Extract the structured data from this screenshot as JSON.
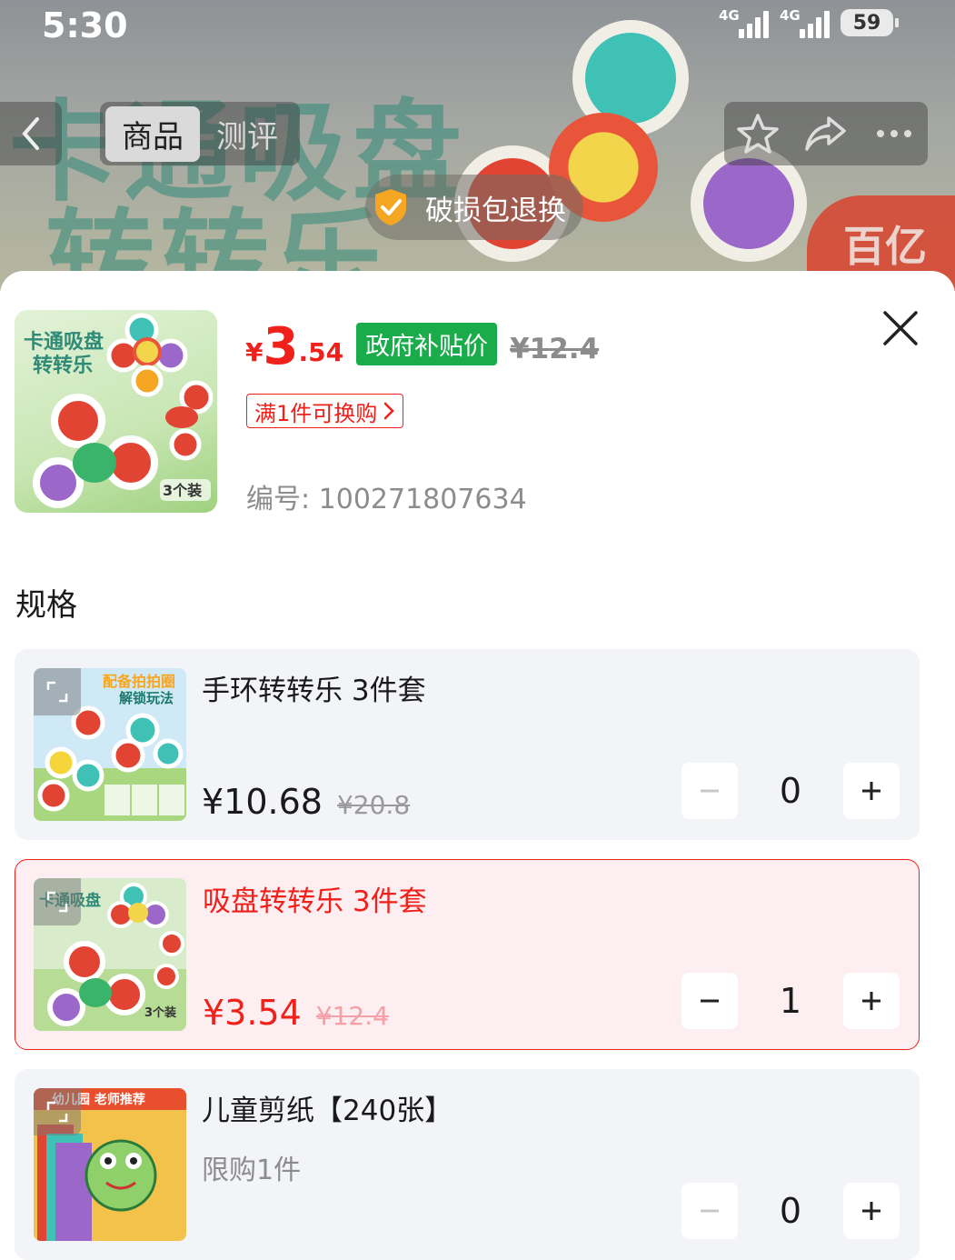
{
  "status_bar": {
    "time": "5:30",
    "network1": "4G",
    "network2": "4G",
    "battery": "59"
  },
  "header": {
    "tabs": [
      {
        "label": "商品",
        "active": true
      },
      {
        "label": "测评",
        "active": false
      }
    ],
    "banner_text_line1": "卡通吸盘",
    "banner_text_line2": "转转乐",
    "banner_corner": "百亿",
    "guarantee": "破损包退换"
  },
  "product": {
    "currency": "¥",
    "price_int": "3",
    "price_dec": ".54",
    "subsidy_tag": "政府补贴价",
    "original_price": "¥12.4",
    "promo": "满1件可换购",
    "sku_number": "编号: 100271807634",
    "thumb_label": "3个装",
    "thumb_title": "卡通吸盘转转乐"
  },
  "spec": {
    "title": "规格",
    "options": [
      {
        "name": "手环转转乐 3件套",
        "price": "¥10.68",
        "original": "¥20.8",
        "quantity": "0",
        "selected": false,
        "thumb_text1": "配备拍拍圈",
        "thumb_text2": "解锁玩法"
      },
      {
        "name": "吸盘转转乐 3件套",
        "price": "¥3.54",
        "original": "¥12.4",
        "quantity": "1",
        "selected": true,
        "thumb_text1": "卡通吸盘",
        "thumb_text2": "3个装"
      },
      {
        "name": "儿童剪纸【240张】",
        "limit": "限购1件",
        "price": "",
        "original": "",
        "quantity": "0",
        "selected": false,
        "thumb_text1": "幼儿园 老师推荐"
      }
    ]
  },
  "colors": {
    "accent_red": "#f0201a",
    "subsidy_green": "#1aac4a",
    "card_bg": "#f3f4f8",
    "selected_bg": "#fdeef1"
  }
}
